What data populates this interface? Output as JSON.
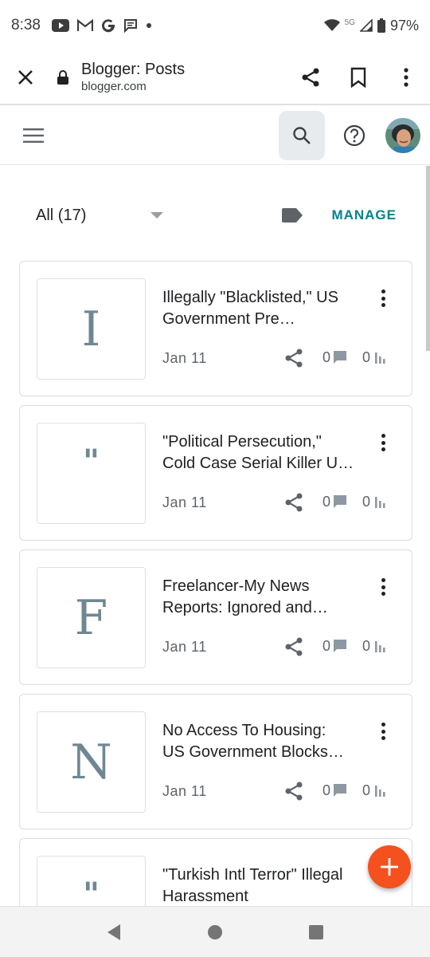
{
  "status_bar": {
    "time": "8:38",
    "network": "5G",
    "battery": "97%",
    "notification_icons": [
      "youtube-icon",
      "gmail-icon",
      "google-icon",
      "chat-icon",
      "dot-icon"
    ]
  },
  "browser": {
    "title": "Blogger: Posts",
    "url": "blogger.com"
  },
  "filter": {
    "label": "All (17)",
    "manage_label": "MANAGE"
  },
  "posts": [
    {
      "thumb": "I",
      "title_line1": "Illegally \"Blacklisted,\" US",
      "title_line2": "Government Pre…",
      "date": "Jan 11",
      "comments": "0",
      "views": "0"
    },
    {
      "thumb": "\"",
      "title_line1": "\"Political Persecution,\"",
      "title_line2": "Cold Case Serial Killer U…",
      "date": "Jan 11",
      "comments": "0",
      "views": "0"
    },
    {
      "thumb": "F",
      "title_line1": "Freelancer-My News",
      "title_line2": "Reports: Ignored and…",
      "date": "Jan 11",
      "comments": "0",
      "views": "0"
    },
    {
      "thumb": "N",
      "title_line1": "No Access To Housing:",
      "title_line2": "US Government Blocks…",
      "date": "Jan 11",
      "comments": "0",
      "views": "0"
    },
    {
      "thumb": "\"",
      "title_line1": "\"Turkish Intl Terror\" Illegal",
      "title_line2": "Harassment",
      "date": "",
      "comments": "",
      "views": ""
    }
  ],
  "colors": {
    "accent": "#00838f",
    "fab": "#f4511e",
    "thumb_text": "#6f8793"
  }
}
